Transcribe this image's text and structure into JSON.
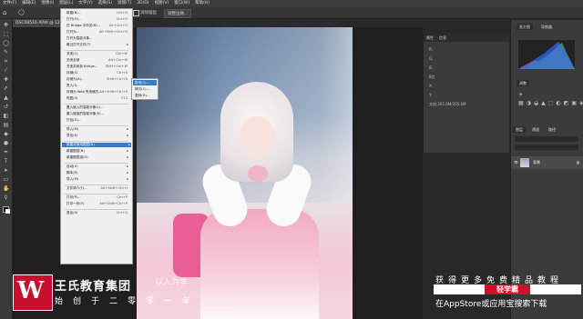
{
  "menubar": [
    "文件(F)",
    "编辑(E)",
    "图像(I)",
    "图层(L)",
    "文字(Y)",
    "选择(S)",
    "滤镜(T)",
    "3D(D)",
    "视图(V)",
    "窗口(W)",
    "帮助(H)"
  ],
  "options_bar": {
    "checkbox_label": "消除锯齿",
    "button_label": "调整边缘..."
  },
  "document_tab": "DSC08516.ARW @ 12.4%(RGB/8)",
  "file_menu": [
    {
      "label": "新建(N)...",
      "shortcut": "Ctrl+N"
    },
    {
      "label": "打开(O)...",
      "shortcut": "Ctrl+O"
    },
    {
      "label": "在 Bridge 中浏览(B)...",
      "shortcut": "Alt+Ctrl+O"
    },
    {
      "label": "打开为...",
      "shortcut": "Alt+Shift+Ctrl+O"
    },
    {
      "label": "打开为智能对象...",
      "shortcut": ""
    },
    {
      "label": "最近打开文件(T)",
      "arrow": true
    },
    {
      "sep": true
    },
    {
      "label": "关闭(C)",
      "shortcut": "Ctrl+W"
    },
    {
      "label": "关闭全部",
      "shortcut": "Alt+Ctrl+W"
    },
    {
      "label": "关闭并转到 Bridge...",
      "shortcut": "Shift+Ctrl+W"
    },
    {
      "label": "存储(S)",
      "shortcut": "Ctrl+S"
    },
    {
      "label": "存储为(A)...",
      "shortcut": "Shift+Ctrl+S"
    },
    {
      "label": "签入(I)...",
      "shortcut": ""
    },
    {
      "label": "存储为 Web 所用格式...",
      "shortcut": "Alt+Shift+Ctrl+S"
    },
    {
      "label": "恢复(V)",
      "shortcut": "F12"
    },
    {
      "sep": true
    },
    {
      "label": "置入嵌入的智能对象(L)...",
      "shortcut": ""
    },
    {
      "label": "置入链接的智能对象(K)...",
      "shortcut": ""
    },
    {
      "label": "打包(G)...",
      "shortcut": ""
    },
    {
      "sep": true
    },
    {
      "label": "导入(M)",
      "arrow": true
    },
    {
      "label": "导出(E)",
      "arrow": true
    },
    {
      "sep": true
    },
    {
      "label": "新建或使用图层(N)",
      "arrow": true,
      "highlight": true
    },
    {
      "label": "新建图层(N)",
      "arrow": true
    },
    {
      "label": "新建图层组(G)",
      "arrow": true
    },
    {
      "sep": true
    },
    {
      "label": "自动(U)",
      "arrow": true
    },
    {
      "label": "脚本(R)",
      "arrow": true
    },
    {
      "label": "导入(M)",
      "arrow": true
    },
    {
      "sep": true
    },
    {
      "label": "文件简介(F)...",
      "shortcut": "Alt+Shift+Ctrl+I"
    },
    {
      "sep": true
    },
    {
      "label": "打印(P)...",
      "shortcut": "Ctrl+P"
    },
    {
      "label": "打印一份(Y)",
      "shortcut": "Alt+Shift+Ctrl+P"
    },
    {
      "sep": true
    },
    {
      "label": "退出(X)",
      "shortcut": "Ctrl+Q"
    }
  ],
  "submenu": [
    "剪切(C)...",
    "拷贝(C)...",
    "复制(D)..."
  ],
  "panel_mid": {
    "tabs": [
      "属性",
      "信息"
    ],
    "lines": [
      "R:",
      "G:",
      "B:",
      "8位",
      "X:",
      "Y:",
      "文档:205.6M/205.6M"
    ]
  },
  "panel_right": {
    "tabs": [
      "直方图",
      "导航器"
    ],
    "adjust_tab": "调整",
    "layers_tabs": [
      "图层",
      "通道",
      "路径"
    ],
    "layer_name": "背景"
  },
  "overlay": {
    "logo_letter": "W",
    "brand_name": "王氏教育集团",
    "brand_tagline": "始创于二零零一年",
    "watermark": "以人为本",
    "promo_line1": "获得更多免费精品教程",
    "promo_app": "轻学霸",
    "promo_line2": "在AppStore或应用宝搜索下载"
  }
}
